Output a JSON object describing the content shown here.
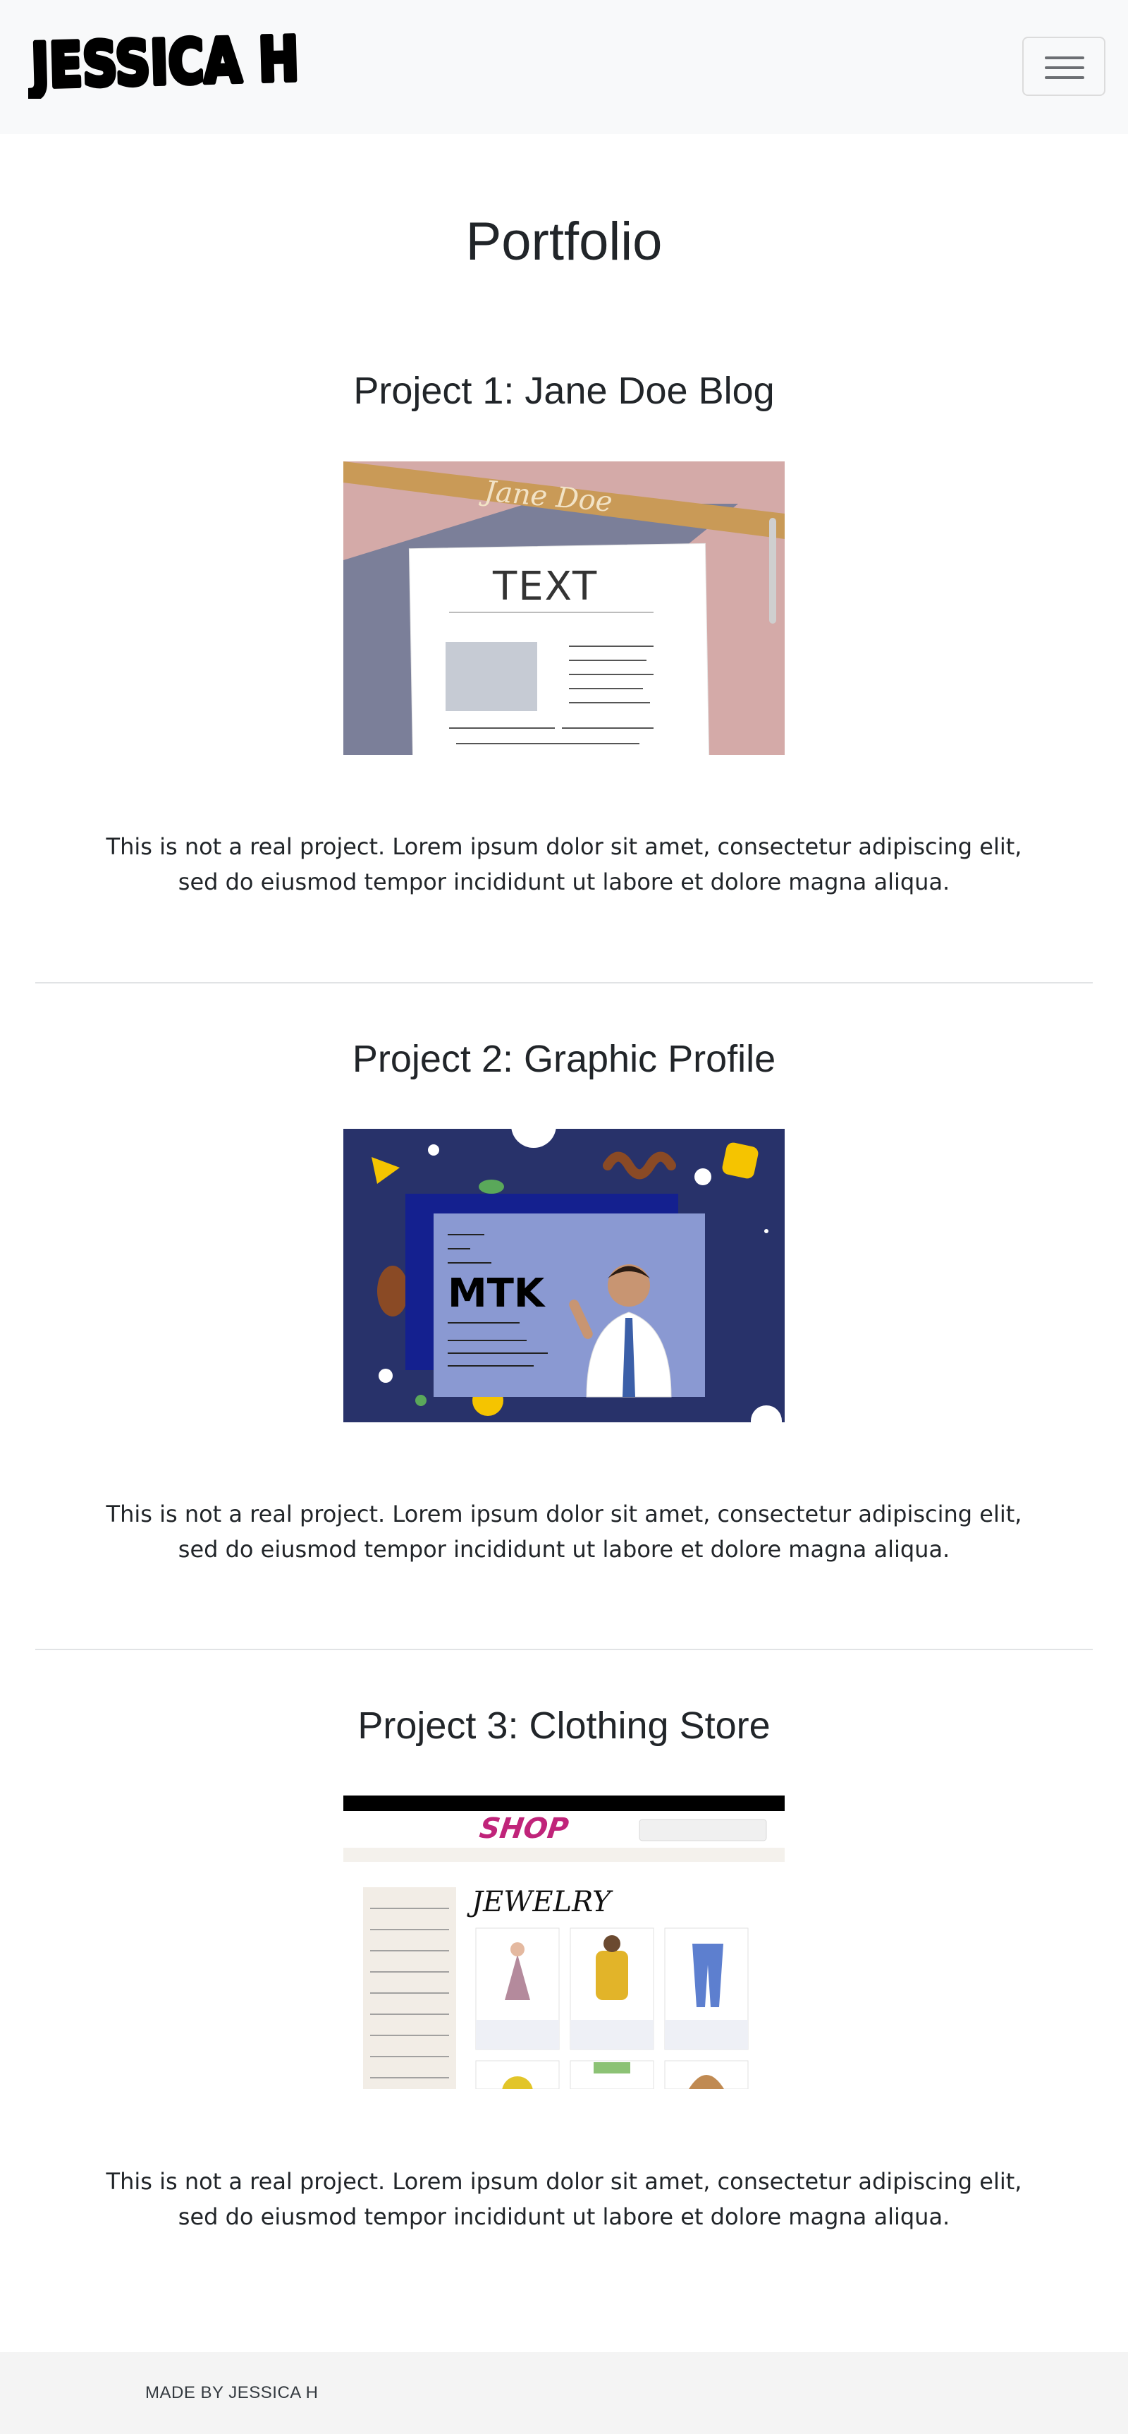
{
  "navbar": {
    "brand_text": "JESSICA H",
    "toggler_icon": "hamburger-menu-icon"
  },
  "main": {
    "page_title": "Portfolio",
    "projects": [
      {
        "title": "Project 1: Jane Doe Blog",
        "image_text": [
          "Jane Doe",
          "TEXT"
        ],
        "description": "This is not a real project. Lorem ipsum dolor sit amet, consectetur adipiscing elit, sed do eiusmod tempor incididunt ut labore et dolore magna aliqua."
      },
      {
        "title": "Project 2: Graphic Profile",
        "description": "This is not a real project. Lorem ipsum dolor sit amet, consectetur adipiscing elit, sed do eiusmod tempor incididunt ut labore et dolore magna aliqua."
      },
      {
        "title": "Project 3: Clothing Store",
        "image_text": [
          "SHOP",
          "JEWELRY"
        ],
        "description": "This is not a real project. Lorem ipsum dolor sit amet, consectetur adipiscing elit, sed do eiusmod tempor incididunt ut labore et dolore magna aliqua."
      }
    ]
  },
  "footer": {
    "text": "MADE BY JESSICA H"
  },
  "colors": {
    "navbar_bg": "#f8f9fa",
    "footer_bg": "#f4f4f4",
    "divider": "#e1e3e5"
  }
}
